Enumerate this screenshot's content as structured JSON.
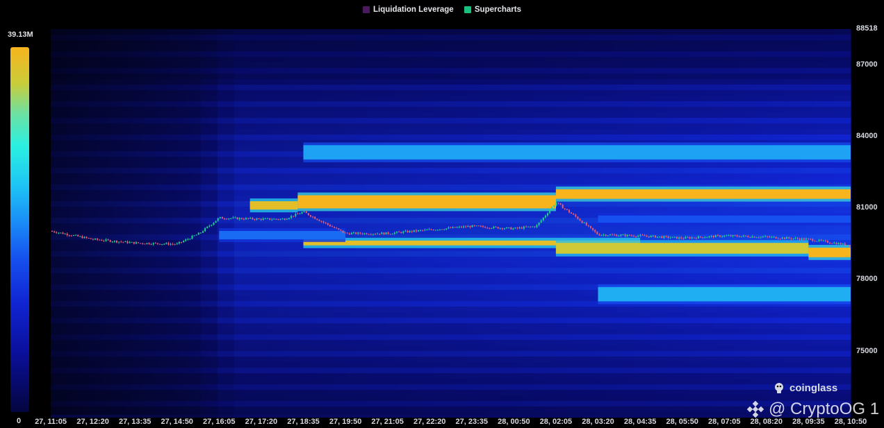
{
  "legend": [
    {
      "label": "Liquidation Leverage",
      "color": "#4a1a5e"
    },
    {
      "label": "Supercharts",
      "color": "#18c27e"
    }
  ],
  "color_scale": {
    "max_label": "39.13M",
    "min_label": "0"
  },
  "brand": {
    "name": "coinglass"
  },
  "watermark": {
    "text": "@ CryptoOG 1"
  },
  "chart_data": {
    "type": "heatmap",
    "xlabel": "",
    "ylabel": "",
    "x_tick_labels": [
      "27, 11:05",
      "27, 12:20",
      "27, 13:35",
      "27, 14:50",
      "27, 16:05",
      "27, 17:20",
      "27, 18:35",
      "27, 19:50",
      "27, 21:05",
      "27, 22:20",
      "27, 23:35",
      "28, 00:50",
      "28, 02:05",
      "28, 03:20",
      "28, 04:35",
      "28, 05:50",
      "28, 07:05",
      "28, 08:20",
      "28, 09:35",
      "28, 10:50"
    ],
    "y_tick_labels": [
      "88518",
      "87000",
      "84000",
      "81000",
      "78000",
      "75000"
    ],
    "ylim": [
      72340,
      88518
    ],
    "colorscale": {
      "min": 0,
      "max": 39.13,
      "unit": "M"
    },
    "liquidation_bands": [
      {
        "price_low": 80950,
        "price_high": 81300,
        "x_start": "27, 17:00",
        "x_end": "27, 18:25",
        "intensity": 0.95
      },
      {
        "price_low": 81000,
        "price_high": 81550,
        "x_start": "27, 18:25",
        "x_end": "28, 02:05",
        "intensity": 1.0
      },
      {
        "price_low": 81400,
        "price_high": 81800,
        "x_start": "28, 02:05",
        "x_end": "28, 10:50",
        "intensity": 1.0
      },
      {
        "price_low": 79450,
        "price_high": 79650,
        "x_start": "27, 18:35",
        "x_end": "28, 04:35",
        "intensity": 0.95
      },
      {
        "price_low": 79100,
        "price_high": 79550,
        "x_start": "28, 02:05",
        "x_end": "28, 09:35",
        "intensity": 0.9
      },
      {
        "price_low": 78950,
        "price_high": 79350,
        "x_start": "28, 09:35",
        "x_end": "28, 10:50",
        "intensity": 1.0
      },
      {
        "price_low": 83050,
        "price_high": 83650,
        "x_start": "27, 18:35",
        "x_end": "28, 10:50",
        "intensity": 0.6
      },
      {
        "price_low": 77100,
        "price_high": 77700,
        "x_start": "28, 03:20",
        "x_end": "28, 10:50",
        "intensity": 0.62
      },
      {
        "price_low": 79700,
        "price_high": 80050,
        "x_start": "27, 16:05",
        "x_end": "27, 19:50",
        "intensity": 0.5
      },
      {
        "price_low": 80400,
        "price_high": 80700,
        "x_start": "28, 03:20",
        "x_end": "28, 10:50",
        "intensity": 0.45
      }
    ],
    "price_series": {
      "name": "",
      "x": [
        "27, 11:05",
        "27, 12:20",
        "27, 13:35",
        "27, 14:50",
        "27, 15:30",
        "27, 16:05",
        "27, 17:20",
        "27, 18:00",
        "27, 18:35",
        "27, 19:20",
        "27, 19:50",
        "27, 21:05",
        "27, 22:20",
        "27, 23:35",
        "28, 00:50",
        "28, 01:30",
        "28, 02:05",
        "28, 02:40",
        "28, 03:20",
        "28, 04:35",
        "28, 05:50",
        "28, 07:05",
        "28, 08:20",
        "28, 09:35",
        "28, 10:50"
      ],
      "y": [
        80050,
        79700,
        79550,
        79500,
        79950,
        80600,
        80550,
        80550,
        80850,
        80300,
        79950,
        79950,
        80100,
        80250,
        80150,
        80250,
        81250,
        80650,
        79900,
        79850,
        79750,
        79850,
        79800,
        79700,
        79450
      ]
    }
  }
}
